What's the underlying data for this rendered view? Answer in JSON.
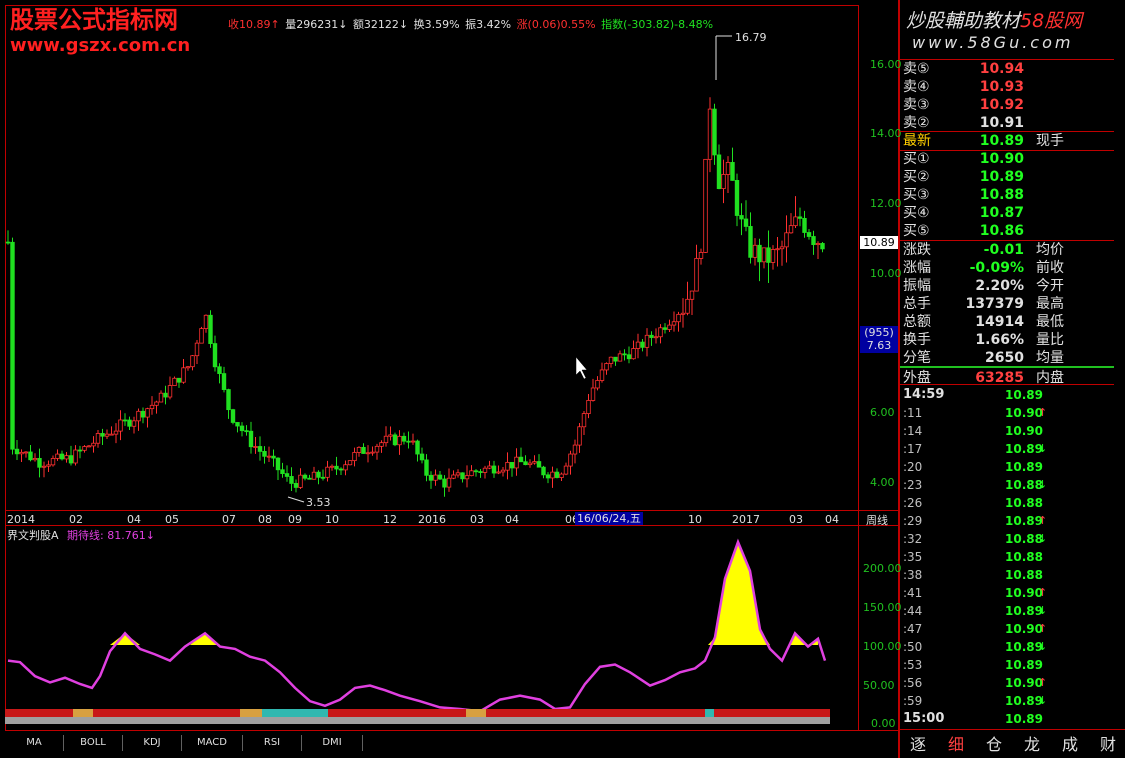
{
  "watermark_left": {
    "line1": "股票公式指标网",
    "line2": "www.gszx.com.cn"
  },
  "watermark_right": {
    "line1": "炒股輔助教材",
    "line1b": "58股网",
    "line2": "www.58Gu.com"
  },
  "info_bar": {
    "close": "收10.89↑",
    "volume": "量296231↓",
    "amount": "额32122↓",
    "turnover": "换3.59%",
    "amplitude": "振3.42%",
    "change": "涨(0.06)0.55%",
    "index": "指数(-303.82)-8.48%"
  },
  "main_chart": {
    "y_ticks": [
      "16.00",
      "14.00",
      "12.00",
      "10.00",
      "8.00",
      "6.00",
      "4.00"
    ],
    "high_label": "16.79",
    "low_label": "3.53",
    "last_price_tag": "10.89",
    "cursor_count": "(955)",
    "cursor_price": "7.63",
    "x_labels": [
      "2014",
      "02",
      "04",
      "05",
      "07",
      "08",
      "09",
      "10",
      "12",
      "2016",
      "03",
      "04",
      "06",
      "10",
      "2017",
      "03",
      "04"
    ],
    "date_cursor": "16/06/24,五",
    "period": "周线",
    "colors": {
      "up": "#ff3030",
      "down": "#20e020",
      "axis": "#c00000",
      "tick_text": "#20c020"
    }
  },
  "indicator": {
    "name": "界文判股A",
    "line_label": "期待线: 81.761↓",
    "y_ticks": [
      "200.00",
      "150.00",
      "100.00",
      "50.00",
      "0.00"
    ],
    "colors": {
      "line": "#e040e0",
      "fill": "#ffff00"
    }
  },
  "bottom_tabs": [
    "MA",
    "BOLL",
    "KDJ",
    "MACD",
    "RSI",
    "DMI"
  ],
  "side_tabs": [
    "逐",
    "细",
    "仓",
    "龙",
    "成",
    "财"
  ],
  "quote": {
    "asks": [
      {
        "label": "卖⑤",
        "price": "10.94"
      },
      {
        "label": "卖④",
        "price": "10.93"
      },
      {
        "label": "卖③",
        "price": "10.92"
      },
      {
        "label": "卖②",
        "price": "10.91"
      }
    ],
    "latest": {
      "label": "最新",
      "price": "10.89",
      "extra": "现手"
    },
    "bids": [
      {
        "label": "买①",
        "price": "10.90"
      },
      {
        "label": "买②",
        "price": "10.89"
      },
      {
        "label": "买③",
        "price": "10.88"
      },
      {
        "label": "买④",
        "price": "10.87"
      },
      {
        "label": "买⑤",
        "price": "10.86"
      }
    ],
    "stats": [
      {
        "label": "涨跌",
        "value": "-0.01",
        "label2": "均价"
      },
      {
        "label": "涨幅",
        "value": "-0.09%",
        "label2": "前收"
      },
      {
        "label": "振幅",
        "value": "2.20%",
        "label2": "今开"
      },
      {
        "label": "总手",
        "value": "137379",
        "label2": "最高"
      },
      {
        "label": "总额",
        "value": "14914",
        "label2": "最低"
      },
      {
        "label": "换手",
        "value": "1.66%",
        "label2": "量比"
      },
      {
        "label": "分笔",
        "value": "2650",
        "label2": "均量"
      },
      {
        "label": "外盘",
        "value": "63285",
        "label2": "内盘"
      }
    ]
  },
  "ticks": [
    {
      "time": "14:59",
      "price": "10.89",
      "arrow": ""
    },
    {
      "time": ":11",
      "price": "10.90",
      "arrow": "↑"
    },
    {
      "time": ":14",
      "price": "10.90",
      "arrow": ""
    },
    {
      "time": ":17",
      "price": "10.89",
      "arrow": "↓"
    },
    {
      "time": ":20",
      "price": "10.89",
      "arrow": ""
    },
    {
      "time": ":23",
      "price": "10.88",
      "arrow": "↓"
    },
    {
      "time": ":26",
      "price": "10.88",
      "arrow": ""
    },
    {
      "time": ":29",
      "price": "10.89",
      "arrow": "↑"
    },
    {
      "time": ":32",
      "price": "10.88",
      "arrow": "↓"
    },
    {
      "time": ":35",
      "price": "10.88",
      "arrow": ""
    },
    {
      "time": ":38",
      "price": "10.88",
      "arrow": ""
    },
    {
      "time": ":41",
      "price": "10.90",
      "arrow": "↑"
    },
    {
      "time": ":44",
      "price": "10.89",
      "arrow": "↓"
    },
    {
      "time": ":47",
      "price": "10.90",
      "arrow": "↑"
    },
    {
      "time": ":50",
      "price": "10.89",
      "arrow": "↓"
    },
    {
      "time": ":53",
      "price": "10.89",
      "arrow": ""
    },
    {
      "time": ":56",
      "price": "10.90",
      "arrow": "↑"
    },
    {
      "time": ":59",
      "price": "10.89",
      "arrow": "↓"
    },
    {
      "time": "15:00",
      "price": "10.89",
      "arrow": ""
    }
  ]
}
